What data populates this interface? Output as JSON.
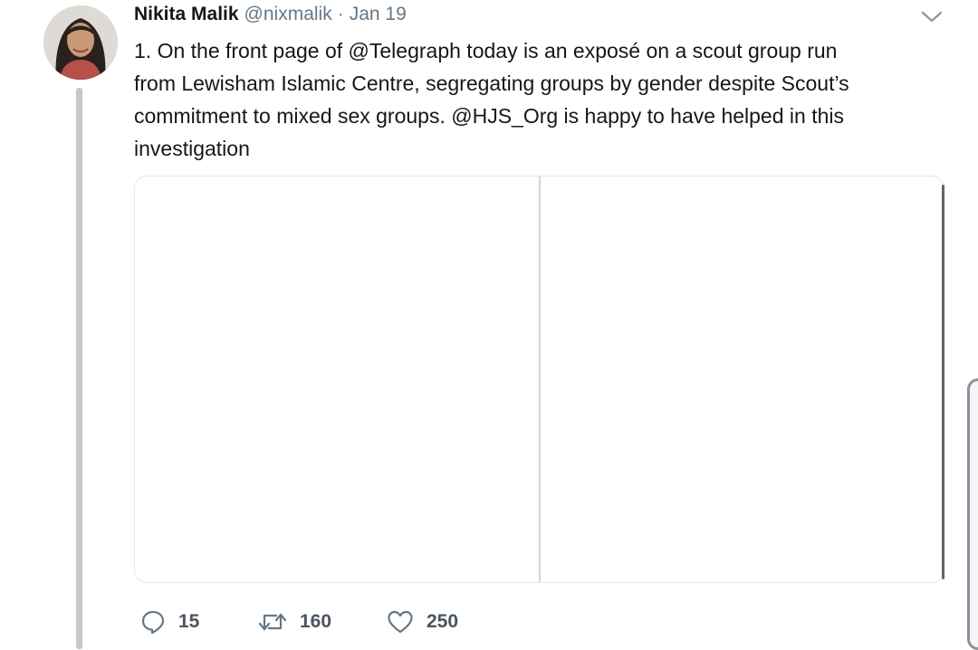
{
  "tweet": {
    "author_name": "Nikita Malik",
    "handle": "@nixmalik",
    "separator": "·",
    "date": "Jan 19",
    "text_lines": [
      "1. On the front page of @Telegraph today is an exposé on a scout group run",
      "from Lewisham Islamic Centre, segregating groups by gender despite Scout’s",
      "commitment to mixed sex groups. @HJS_Org is happy to have helped in this",
      "investigation"
    ],
    "actions": {
      "reply_count": "15",
      "retweet_count": "160",
      "like_count": "250"
    }
  },
  "icons": {
    "menu": "chevron-down-icon",
    "reply": "reply-icon",
    "retweet": "retweet-icon",
    "like": "heart-icon"
  },
  "colors": {
    "text": "#14171a",
    "secondary": "#657786",
    "border": "#e1e8ed"
  }
}
